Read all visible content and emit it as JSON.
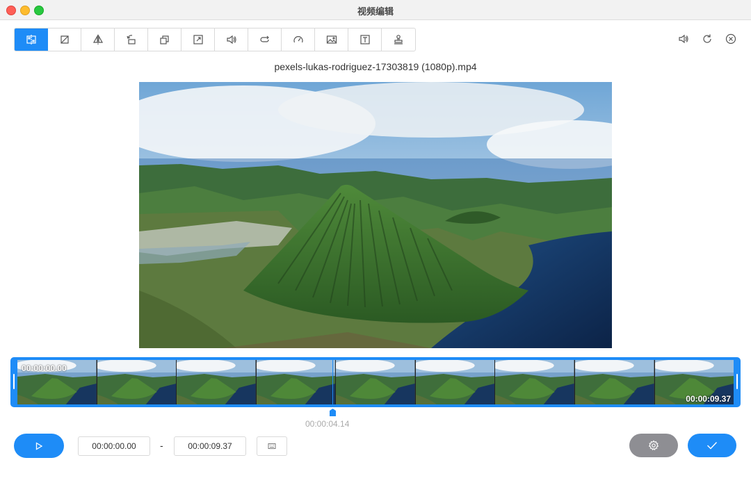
{
  "window": {
    "title": "视频编辑"
  },
  "toolbar": {
    "tools": [
      {
        "icon": "trim-icon",
        "active": true
      },
      {
        "icon": "crop-icon"
      },
      {
        "icon": "flip-icon"
      },
      {
        "icon": "rotate-icon"
      },
      {
        "icon": "layers-icon"
      },
      {
        "icon": "resize-icon"
      },
      {
        "icon": "volume-icon"
      },
      {
        "icon": "loop-icon"
      },
      {
        "icon": "speed-icon"
      },
      {
        "icon": "image-icon"
      },
      {
        "icon": "text-icon"
      },
      {
        "icon": "watermark-stamp-icon"
      }
    ],
    "right": [
      "speaker-icon",
      "refresh-icon",
      "close-circle-icon"
    ]
  },
  "file": {
    "name": "pexels-lukas-rodriguez-17303819 (1080p).mp4"
  },
  "timeline": {
    "start_time": "00:00:00.00",
    "end_time": "00:00:09.37",
    "playhead_time": "00:00:04.14",
    "frame_count": 9,
    "playhead_progress": 0.44
  },
  "controls": {
    "start_input": "00:00:00.00",
    "separator": "-",
    "end_input": "00:00:09.37"
  },
  "colors": {
    "accent": "#1e8cf7",
    "settings_bg": "#8e8e93"
  }
}
